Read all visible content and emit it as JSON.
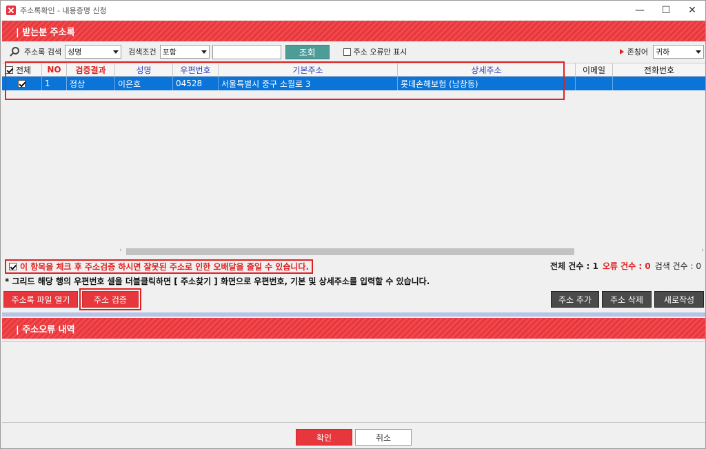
{
  "window": {
    "title": "주소록확인 - 내용증명 신청",
    "controls": [
      "—",
      "☐",
      "✕"
    ]
  },
  "section1": {
    "title": "| 받는분 주소록"
  },
  "toolbar": {
    "search_label": "주소록 검색",
    "search_field": "성명",
    "condition_label": "검색조건",
    "condition_value": "포함",
    "search_text": "",
    "lookup_button": "조회",
    "error_only_label": "주소 오류만 표시",
    "honorific_label": "존칭어",
    "honorific_value": "귀하"
  },
  "grid": {
    "headers": {
      "all": "전체",
      "no": "NO",
      "result": "검증결과",
      "name": "성명",
      "postal": "우편번호",
      "base_addr": "기본주소",
      "detail_addr": "상세주소",
      "email": "이메일",
      "phone": "전화번호"
    },
    "rows": [
      {
        "checked": true,
        "no": "1",
        "result": "정상",
        "name": "이은호",
        "postal": "04528",
        "base_addr": "서울특별시 중구 소월로 3",
        "detail_addr": "롯데손해보험 (남창동)",
        "email": "",
        "phone": ""
      }
    ]
  },
  "notice": {
    "text": "이 항목을 체크 후 주소검증 하시면 잘못된 주소로 인한 오배달을 줄일 수 있습니다."
  },
  "counts": {
    "total_label": "전체 건수 : 1",
    "error_label": "오류 건수 : 0",
    "search_label": "검색 건수 : 0"
  },
  "hint": "* 그리드 해당 행의 우편번호 셀을 더블클릭하면 [ 주소찾기 ] 화면으로 우편번호, 기본 및 상세주소를 입력할 수 있습니다.",
  "buttons": {
    "open_file": "주소록 파일 열기",
    "verify": "주소 검증",
    "add": "주소 추가",
    "delete": "주소 삭제",
    "new": "새로작성",
    "ok": "확인",
    "cancel": "취소"
  },
  "section2": {
    "title": "| 주소오류 내역"
  },
  "colors": {
    "accent_red": "#e8373c",
    "selection_blue": "#0a74d8",
    "teal": "#4e9c97",
    "dark_button": "#4a4a4a"
  }
}
